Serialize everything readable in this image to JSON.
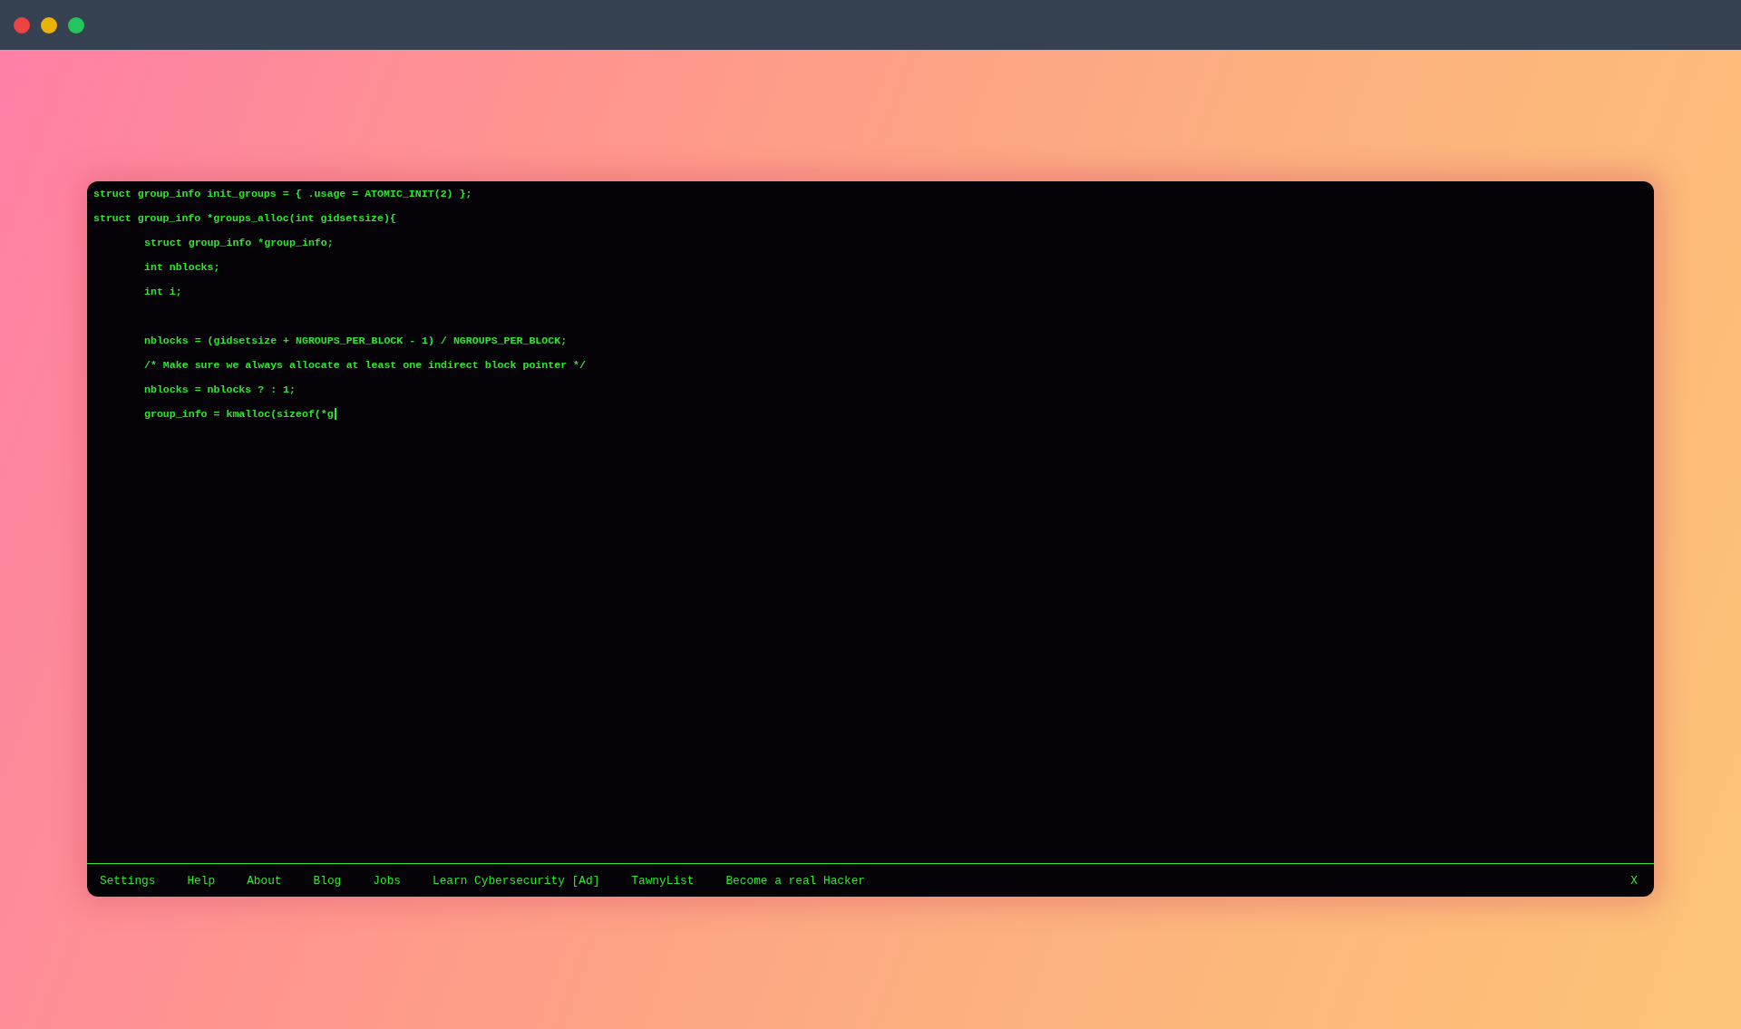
{
  "window": {
    "controls": [
      {
        "color": "#ef4444"
      },
      {
        "color": "#eab308"
      },
      {
        "color": "#22c55e"
      }
    ]
  },
  "code": {
    "lines": [
      {
        "text": "struct group_info init_groups = { .usage = ATOMIC_INIT(2) };"
      },
      {
        "text": "struct group_info *groups_alloc(int gidsetsize){",
        "children": [
          {
            "text": "struct group_info *group_info;"
          },
          {
            "text": "int nblocks;"
          },
          {
            "text": "int i;"
          },
          {
            "text": "nblocks = (gidsetsize + NGROUPS_PER_BLOCK - 1) / NGROUPS_PER_BLOCK;",
            "blank_before": true
          },
          {
            "text": "/* Make sure we always allocate at least one indirect block pointer */"
          },
          {
            "text": "nblocks = nblocks ? : 1;"
          },
          {
            "text": "group_info = kmalloc(sizeof(*g",
            "cursor": true
          }
        ]
      }
    ]
  },
  "footer": {
    "links": [
      "Settings",
      "Help",
      "About",
      "Blog",
      "Jobs",
      "Learn Cybersecurity [Ad]",
      "TawnyList",
      "Become a real Hacker"
    ],
    "close": "X"
  }
}
